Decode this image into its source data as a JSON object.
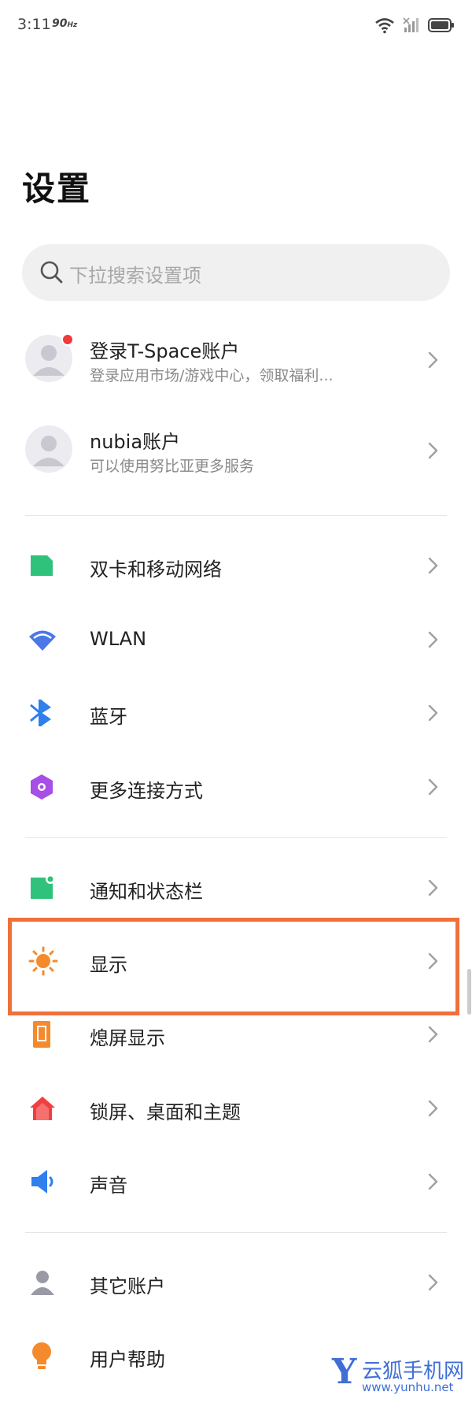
{
  "status_bar": {
    "time": "3:11",
    "refresh": "90",
    "refresh_unit": "Hz"
  },
  "title": "设置",
  "search": {
    "placeholder": "下拉搜索设置项"
  },
  "accounts": [
    {
      "label": "登录T-Space账户",
      "subtitle": "登录应用市场/游戏中心，领取福利..."
    },
    {
      "label": "nubia账户",
      "subtitle": "可以使用努比亚更多服务"
    }
  ],
  "connectivity": [
    {
      "label": "双卡和移动网络",
      "icon": "sim-card-icon",
      "color": "#2fc27a"
    },
    {
      "label": "WLAN",
      "icon": "wifi-icon",
      "color": "#4a78e8"
    },
    {
      "label": "蓝牙",
      "icon": "bluetooth-icon",
      "color": "#2f80ed"
    },
    {
      "label": "更多连接方式",
      "icon": "hexagon-icon",
      "color": "#a64ee6"
    }
  ],
  "display_group": [
    {
      "label": "通知和状态栏",
      "icon": "notification-icon",
      "color": "#2fc27a"
    },
    {
      "label": "显示",
      "icon": "sun-icon",
      "color": "#f58a2c"
    },
    {
      "label": "熄屏显示",
      "icon": "phone-icon",
      "color": "#f58a2c"
    },
    {
      "label": "锁屏、桌面和主题",
      "icon": "home-icon",
      "color": "#ee4040"
    },
    {
      "label": "声音",
      "icon": "speaker-icon",
      "color": "#2f80ed"
    }
  ],
  "other_group": [
    {
      "label": "其它账户",
      "icon": "person-icon",
      "color": "#9a9aa6"
    },
    {
      "label": "用户帮助",
      "icon": "bulb-icon",
      "color": "#f58a2c"
    }
  ],
  "watermark": {
    "letter": "Y",
    "text": "云狐手机网",
    "url": "www.yunhu.net"
  }
}
